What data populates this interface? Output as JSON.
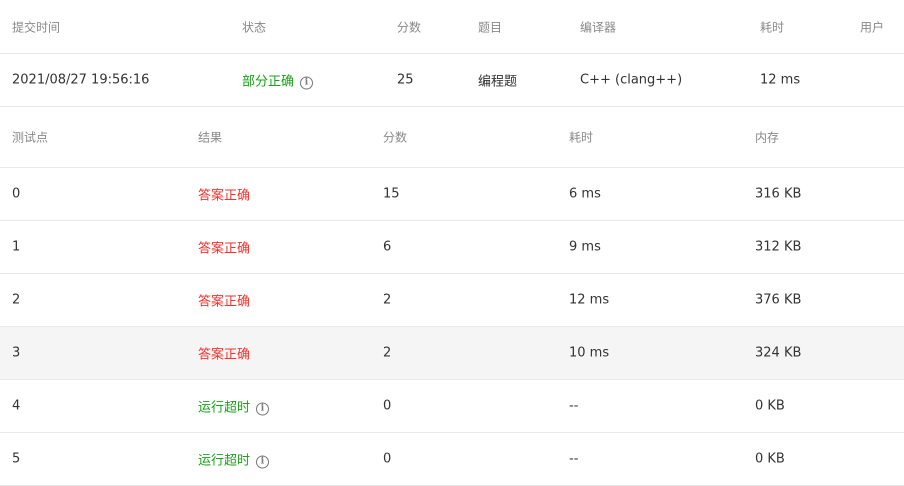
{
  "submission": {
    "headers": [
      "提交时间",
      "状态",
      "分数",
      "题目",
      "编译器",
      "耗时",
      "用户"
    ],
    "row": {
      "time": "2021/08/27 19:56:16",
      "status": "部分正确",
      "score": "25",
      "problem": "编程题",
      "compiler": "C++ (clang++)",
      "elapsed": "12 ms",
      "user": ""
    }
  },
  "tests": {
    "headers": [
      "测试点",
      "结果",
      "分数",
      "耗时",
      "内存"
    ],
    "rows": [
      {
        "id": "0",
        "result": "答案正确",
        "score": "15",
        "time": "6 ms",
        "mem": "316 KB",
        "ok": true
      },
      {
        "id": "1",
        "result": "答案正确",
        "score": "6",
        "time": "9 ms",
        "mem": "312 KB",
        "ok": true
      },
      {
        "id": "2",
        "result": "答案正确",
        "score": "2",
        "time": "12 ms",
        "mem": "376 KB",
        "ok": true
      },
      {
        "id": "3",
        "result": "答案正确",
        "score": "2",
        "time": "10 ms",
        "mem": "324 KB",
        "ok": true
      },
      {
        "id": "4",
        "result": "运行超时",
        "score": "0",
        "time": "--",
        "mem": "0 KB",
        "ok": false
      },
      {
        "id": "5",
        "result": "运行超时",
        "score": "0",
        "time": "--",
        "mem": "0 KB",
        "ok": false
      }
    ]
  },
  "colors": {
    "accepted": "#f5322d",
    "partial": "#1aa11a",
    "timeout": "#1aa11a"
  }
}
